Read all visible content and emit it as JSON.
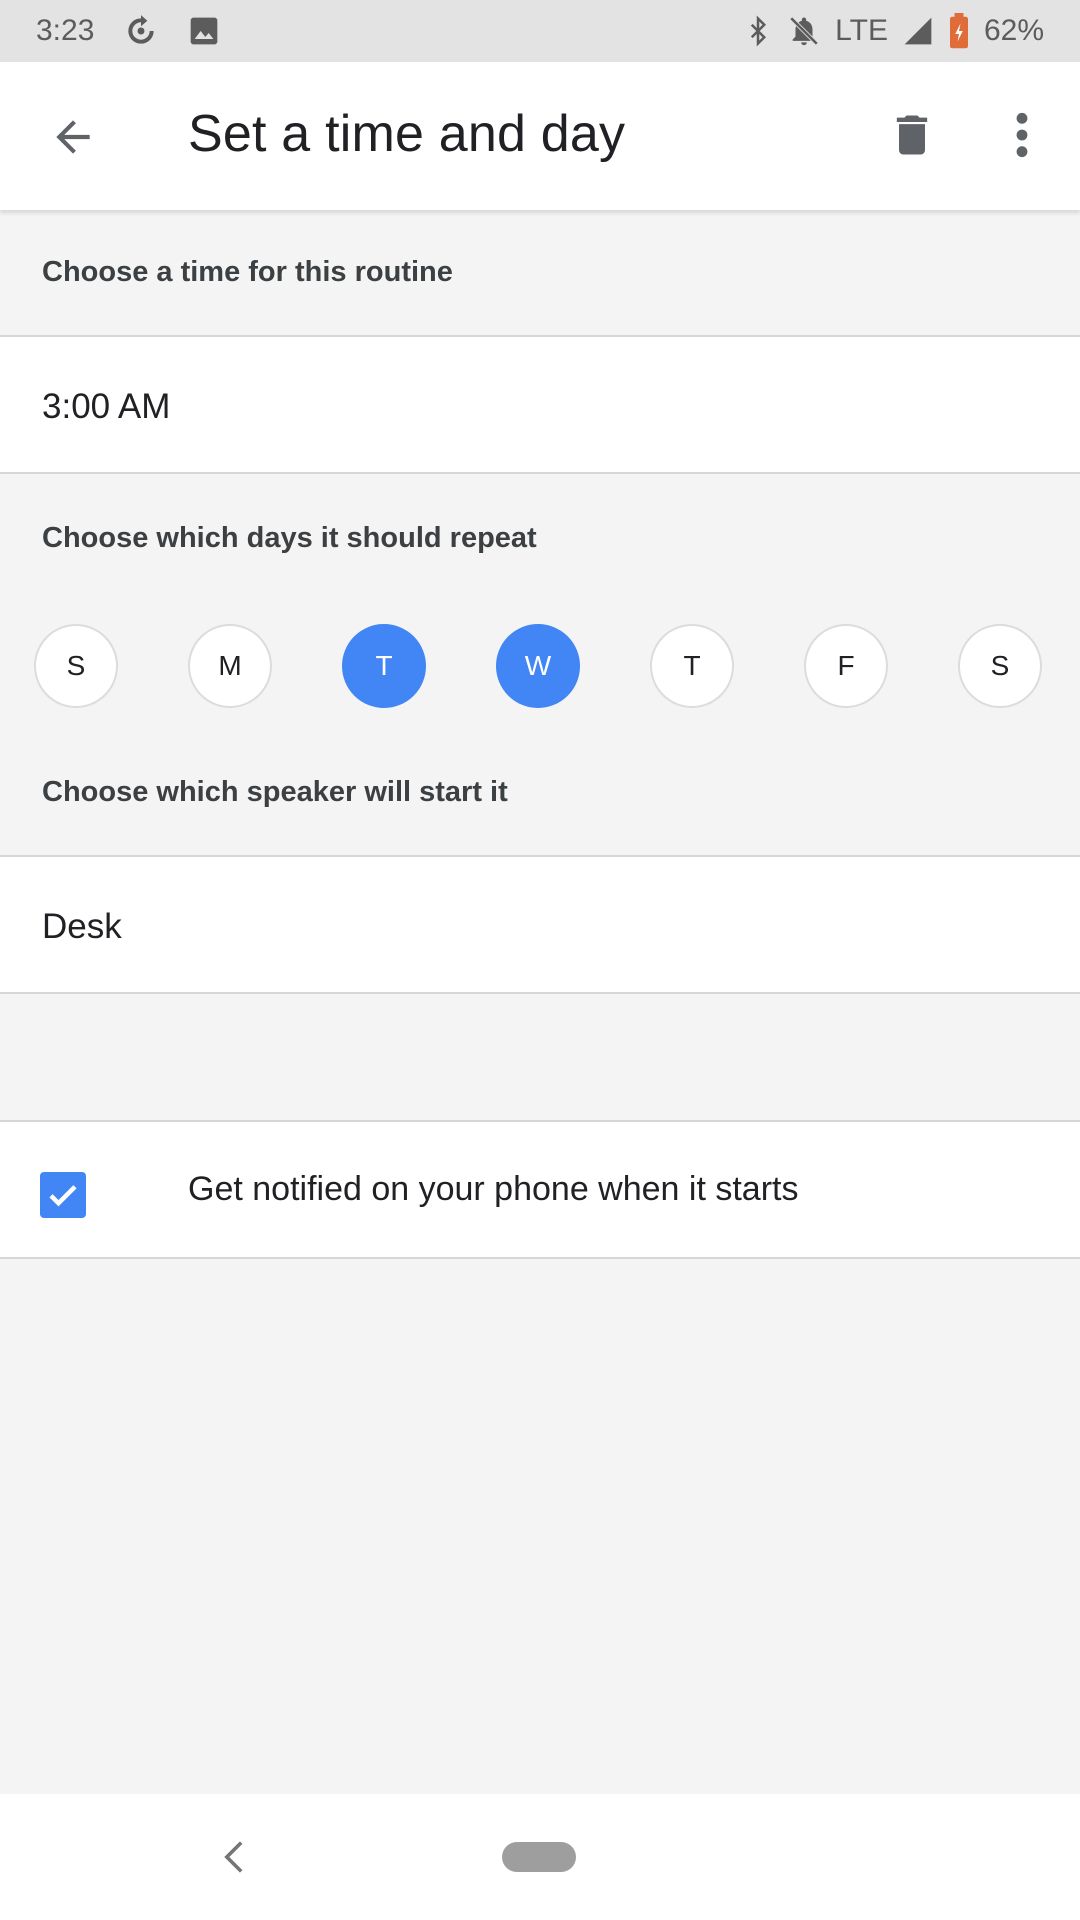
{
  "status_bar": {
    "time": "3:23",
    "network": "LTE",
    "battery": "62%",
    "icons": [
      "sync-icon",
      "image-icon",
      "bluetooth-icon",
      "notifications-off-icon",
      "signal-icon",
      "battery-icon"
    ]
  },
  "app_bar": {
    "title": "Set a time and day",
    "icons": [
      "back-arrow-icon",
      "delete-icon",
      "more-vert-icon"
    ]
  },
  "time_section": {
    "label": "Choose a time for this routine",
    "value": "3:00 AM"
  },
  "days_section": {
    "label": "Choose which days it should repeat",
    "days": [
      {
        "letter": "S",
        "selected": false
      },
      {
        "letter": "M",
        "selected": false
      },
      {
        "letter": "T",
        "selected": true
      },
      {
        "letter": "W",
        "selected": true
      },
      {
        "letter": "T",
        "selected": false
      },
      {
        "letter": "F",
        "selected": false
      },
      {
        "letter": "S",
        "selected": false
      }
    ]
  },
  "speaker_section": {
    "label": "Choose which speaker will start it",
    "value": "Desk"
  },
  "notify": {
    "checked": true,
    "label": "Get notified on your phone when it starts"
  },
  "colors": {
    "accent": "#4285f4",
    "status_bar_bg": "#e3e3e3",
    "page_bg": "#f4f4f4"
  }
}
